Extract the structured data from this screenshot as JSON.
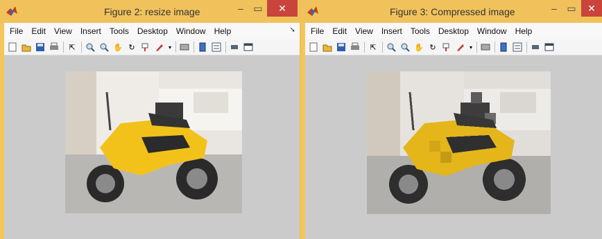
{
  "windows": [
    {
      "title": "Figure 2: resize image",
      "menu": [
        "File",
        "Edit",
        "View",
        "Insert",
        "Tools",
        "Desktop",
        "Window",
        "Help"
      ]
    },
    {
      "title": "Figure 3: Compressed image",
      "menu": [
        "File",
        "Edit",
        "View",
        "Insert",
        "Tools",
        "Desktop",
        "Window",
        "Help"
      ]
    }
  ],
  "colors": {
    "titlebar": "#f1c25b",
    "close": "#c9443a",
    "canvas": "#cbcbcb",
    "bike": "#f3c21a"
  },
  "icons": [
    "new-file-icon",
    "open-folder-icon",
    "save-icon",
    "print-icon",
    "pointer-icon",
    "zoom-in-icon",
    "zoom-out-icon",
    "pan-hand-icon",
    "rotate-icon",
    "data-cursor-icon",
    "brush-icon",
    "link-icon",
    "colorbar-icon",
    "legend-icon",
    "hide-tools-icon",
    "show-tools-icon"
  ]
}
